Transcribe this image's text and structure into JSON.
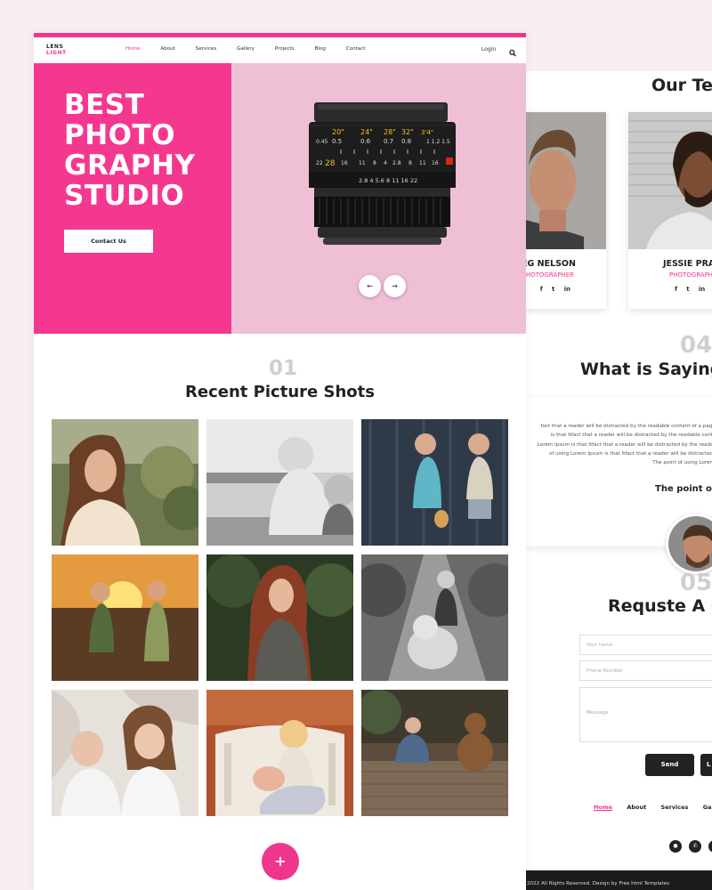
{
  "front": {
    "logo": {
      "line1": "LENS",
      "line2": "LIGHT"
    },
    "nav": {
      "items": [
        "Home",
        "About",
        "Services",
        "Gallery",
        "Projects",
        "Blog",
        "Contact"
      ],
      "login": "Login"
    },
    "hero": {
      "title_lines": [
        "BEST",
        "PHOTO",
        "GRAPHY",
        "STUDIO"
      ],
      "button": "Contact Us",
      "prev": "←",
      "next": "→"
    },
    "gallery_section": {
      "number": "01",
      "title": "Recent Picture Shots"
    },
    "load_more": "+"
  },
  "back": {
    "team": {
      "title": "Our Te",
      "members": [
        {
          "name": "EG NELSON",
          "role": "PHOTOGRAPHER",
          "social": [
            "f",
            "t",
            "in"
          ]
        },
        {
          "name": "JESSIE PRA",
          "role": "PHOTOGRAPHER",
          "social": [
            "f",
            "t",
            "in"
          ]
        }
      ]
    },
    "testimonial": {
      "number": "04",
      "title": "What is Saying",
      "lines": [
        "fact that a reader will be distracted by the readable content of a page w",
        "is that Itfact that a reader will be distracted by the readable content",
        "Lorem Ipsum is that Itfact that a reader will be distracted by the readable",
        "of using Lorem Ipsum is that Itfact that a reader will be distracted by",
        "The point of using Lorem Ip"
      ],
      "name": "The point of"
    },
    "request": {
      "number": "05",
      "title": "Requste A C",
      "name_placeholder": "Your name",
      "phone_placeholder": "Phone Number",
      "message_placeholder": "Message",
      "send": "Send",
      "second_button": "L"
    },
    "footer": {
      "nav": [
        "Home",
        "About",
        "Services",
        "Gallery"
      ],
      "copyright": "2022 All Rights Reserved. Design by Free html Templates"
    }
  },
  "colors": {
    "accent": "#f0358d",
    "hero_bg": "#efbfd6",
    "dark": "#222222"
  }
}
